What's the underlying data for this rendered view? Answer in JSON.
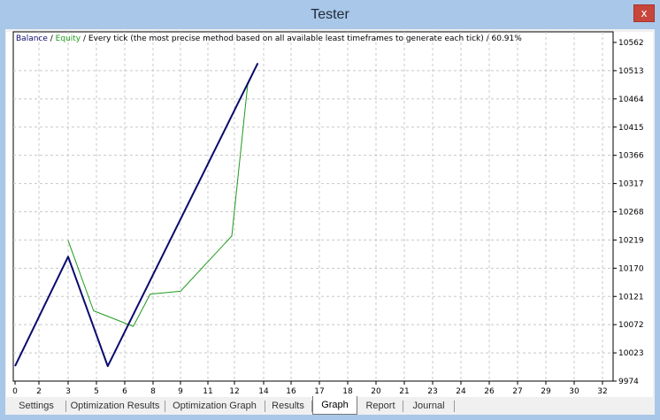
{
  "window": {
    "title": "Tester",
    "close_label": "x"
  },
  "chart_data": {
    "type": "line",
    "header": {
      "balance_label": "Balance",
      "separator1": " / ",
      "equity_label": "Equity",
      "description": " / Every tick (the most precise method based on all available least timeframes to generate each tick) / 60.91%"
    },
    "x_ticks": [
      0,
      2,
      3,
      5,
      6,
      8,
      9,
      11,
      12,
      14,
      16,
      17,
      18,
      20,
      21,
      23,
      24,
      26,
      27,
      29,
      30,
      32
    ],
    "y_ticks": [
      10562,
      10513,
      10464,
      10415,
      10366,
      10317,
      10268,
      10219,
      10170,
      10121,
      10072,
      10023,
      9974
    ],
    "ylim": [
      9974,
      10562
    ],
    "grid": true,
    "series": [
      {
        "name": "Balance",
        "color": "#0a0a6e",
        "x": [
          0,
          3,
          5.4,
          13.6
        ],
        "y": [
          10000,
          10190,
          10000,
          10526
        ]
      },
      {
        "name": "Equity",
        "color": "#1e9a1e",
        "x": [
          0,
          3,
          5.4,
          7.9,
          13.6
        ],
        "y": [
          10000,
          10218,
          10000,
          10130,
          10526
        ]
      },
      {
        "name": "Equity line",
        "color": "#1e9a1e",
        "x": [
          3,
          4.8,
          6.6,
          7.8,
          9.0,
          11.9,
          12.9,
          13.6
        ],
        "y": [
          10218,
          10096,
          10069,
          10125,
          10130,
          10226,
          10488,
          10526
        ]
      }
    ],
    "colors": {
      "balance": "#0a0a6e",
      "equity": "#1e9a1e",
      "grid": "#c8c8c8",
      "axis": "#000000"
    }
  },
  "tabs": [
    {
      "label": "Settings"
    },
    {
      "label": "Optimization Results"
    },
    {
      "label": "Optimization Graph"
    },
    {
      "label": "Results"
    },
    {
      "label": "Graph",
      "active": true
    },
    {
      "label": "Report"
    },
    {
      "label": "Journal"
    }
  ]
}
